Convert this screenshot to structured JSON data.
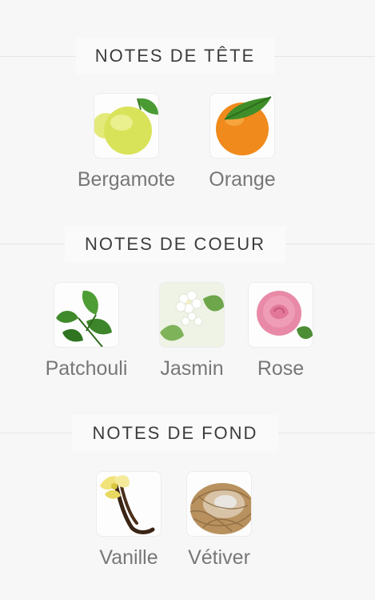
{
  "sections": [
    {
      "title": "NOTES DE TÊTE",
      "items": [
        {
          "label": "Bergamote",
          "icon": "bergamot-icon"
        },
        {
          "label": "Orange",
          "icon": "orange-icon"
        }
      ]
    },
    {
      "title": "NOTES DE COEUR",
      "items": [
        {
          "label": "Patchouli",
          "icon": "patchouli-icon"
        },
        {
          "label": "Jasmin",
          "icon": "jasmine-icon"
        },
        {
          "label": "Rose",
          "icon": "rose-icon"
        }
      ]
    },
    {
      "title": "NOTES DE FOND",
      "items": [
        {
          "label": "Vanille",
          "icon": "vanilla-icon"
        },
        {
          "label": "Vétiver",
          "icon": "vetiver-icon"
        }
      ]
    }
  ]
}
